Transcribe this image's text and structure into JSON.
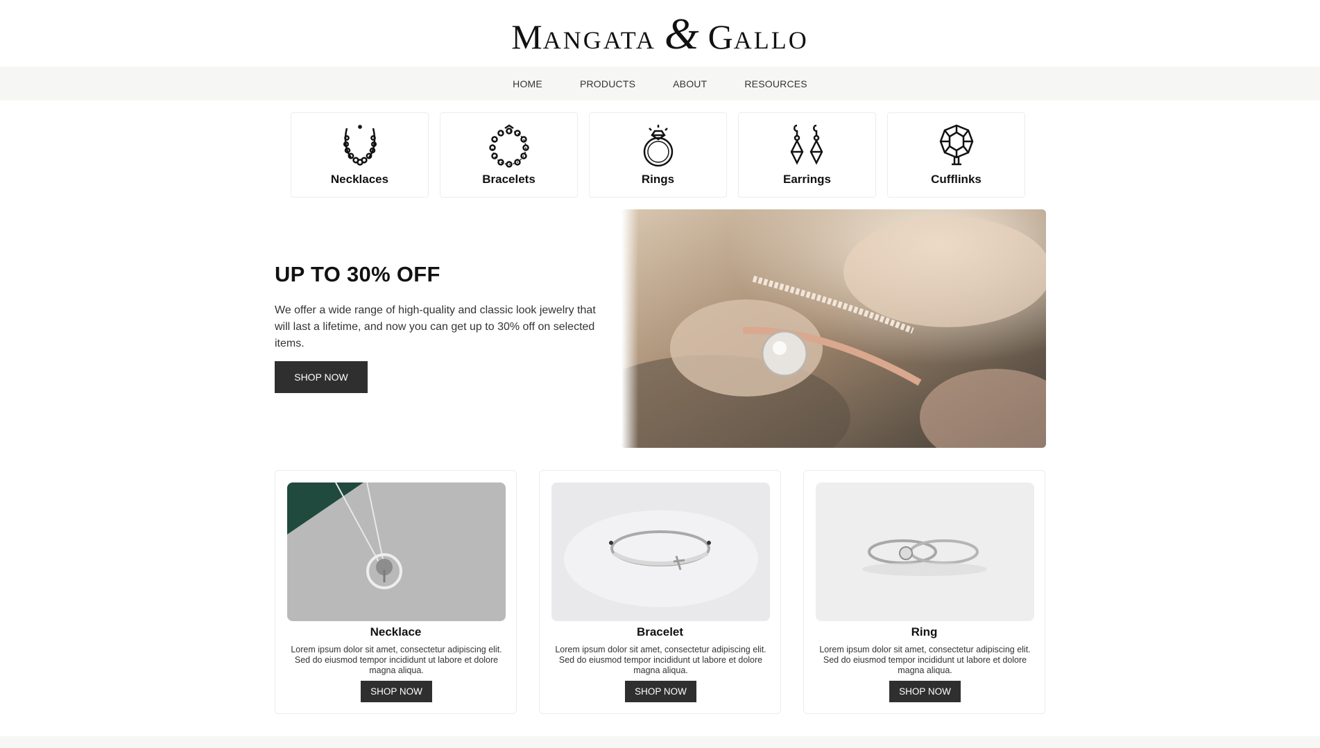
{
  "brand": {
    "logo_m": "M",
    "logo_angata": "ANGATA",
    "logo_amp": "&",
    "logo_g": "G",
    "logo_allo": "ALLO"
  },
  "nav": {
    "items": [
      "HOME",
      "PRODUCTS",
      "ABOUT",
      "RESOURCES"
    ]
  },
  "categories": [
    {
      "label": "Necklaces",
      "icon": "necklace-icon"
    },
    {
      "label": "Bracelets",
      "icon": "bracelet-icon"
    },
    {
      "label": "Rings",
      "icon": "ring-icon"
    },
    {
      "label": "Earrings",
      "icon": "earrings-icon"
    },
    {
      "label": "Cufflinks",
      "icon": "cufflink-icon"
    }
  ],
  "hero": {
    "title": "UP TO 30% OFF",
    "text": "We offer a wide range of high-quality and classic look jewelry that will last a lifetime, and now you can get up to 30% off on selected items.",
    "button": "SHOP NOW"
  },
  "products": [
    {
      "title": "Necklace",
      "desc": "Lorem ipsum dolor sit amet, consectetur adipiscing elit. Sed do eiusmod tempor incididunt ut labore et dolore magna aliqua.",
      "button": "SHOP NOW"
    },
    {
      "title": "Bracelet",
      "desc": "Lorem ipsum dolor sit amet, consectetur adipiscing elit. Sed do eiusmod tempor incididunt ut labore et dolore magna aliqua.",
      "button": "SHOP NOW"
    },
    {
      "title": "Ring",
      "desc": "Lorem ipsum dolor sit amet, consectetur adipiscing elit. Sed do eiusmod tempor incididunt ut labore et dolore magna aliqua.",
      "button": "SHOP NOW"
    }
  ],
  "colors": {
    "button_bg": "#2f2f2f",
    "nav_bg": "#f6f6f4",
    "text": "#111111"
  }
}
